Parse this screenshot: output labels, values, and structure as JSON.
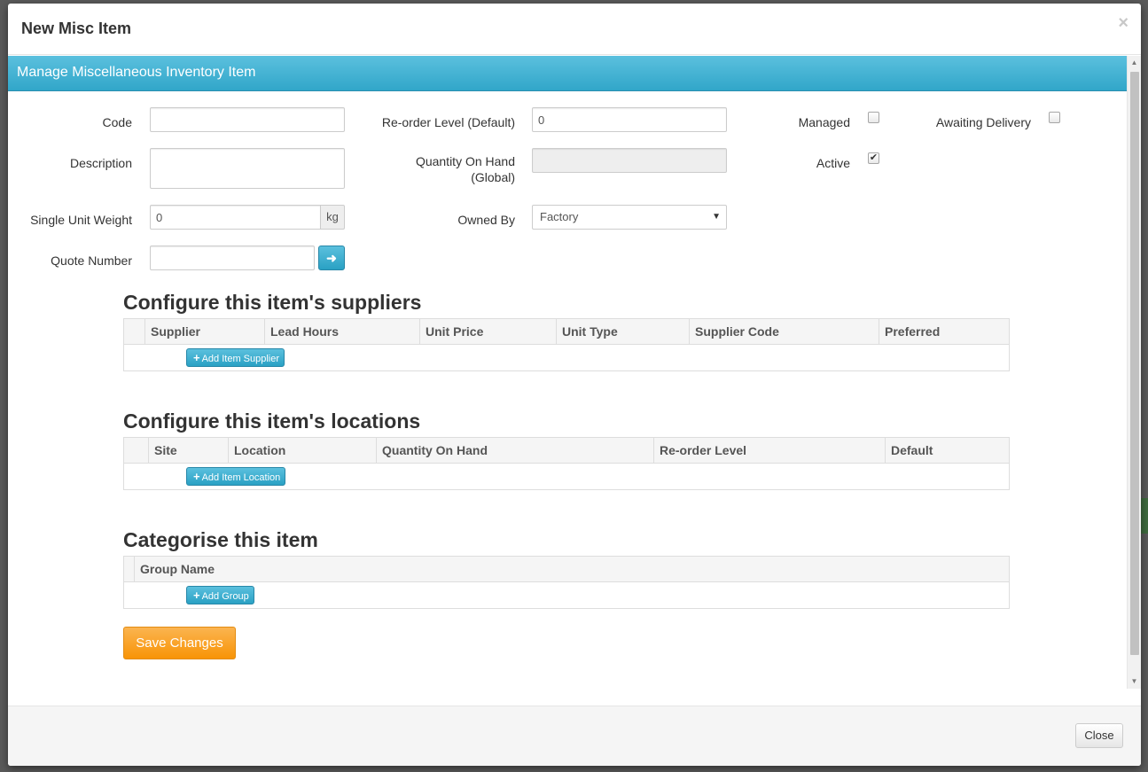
{
  "modal": {
    "title": "New Misc Item",
    "close_glyph": "×"
  },
  "panel": {
    "heading": "Manage Miscellaneous Inventory Item"
  },
  "form": {
    "code": {
      "label": "Code",
      "value": ""
    },
    "description": {
      "label": "Description",
      "value": ""
    },
    "single_unit_weight": {
      "label": "Single Unit Weight",
      "value": "0",
      "unit": "kg"
    },
    "quote_number": {
      "label": "Quote Number",
      "value": "",
      "go_icon": "arrow-right-icon",
      "go_glyph": "➜"
    },
    "reorder_level": {
      "label": "Re-order Level (Default)",
      "value": "0"
    },
    "quantity_on_hand": {
      "label_line1": "Quantity On Hand",
      "label_line2": "(Global)",
      "value": ""
    },
    "owned_by": {
      "label": "Owned By",
      "selected": "Factory",
      "caret": "▼"
    },
    "managed": {
      "label": "Managed",
      "checked": false
    },
    "awaiting_delivery": {
      "label": "Awaiting Delivery",
      "checked": false
    },
    "active": {
      "label": "Active",
      "checked": true,
      "check_glyph": "✔"
    }
  },
  "suppliers": {
    "title": "Configure this item's suppliers",
    "columns": [
      "Supplier",
      "Lead Hours",
      "Unit Price",
      "Unit Type",
      "Supplier Code",
      "Preferred"
    ],
    "add_label": "Add Item Supplier"
  },
  "locations": {
    "title": "Configure this item's locations",
    "columns": [
      "Site",
      "Location",
      "Quantity On Hand",
      "Re-order Level",
      "Default"
    ],
    "add_label": "Add Item Location"
  },
  "groups": {
    "title": "Categorise this item",
    "columns": [
      "Group Name"
    ],
    "add_label": "Add Group"
  },
  "actions": {
    "save_label": "Save Changes",
    "close_label": "Close",
    "plus_glyph": "+"
  },
  "colors": {
    "panel_accent": "#31a6c9",
    "save_orange": "#f89406"
  }
}
